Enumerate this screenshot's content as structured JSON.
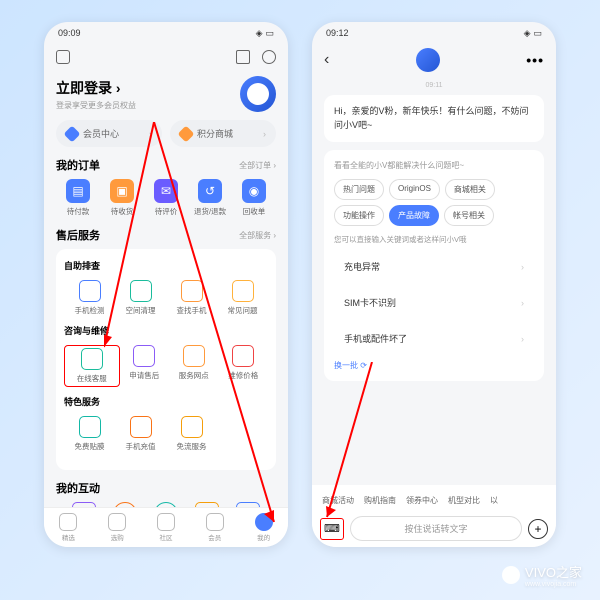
{
  "p1": {
    "time": "09:09",
    "login_title": "立即登录",
    "login_arrow": "›",
    "login_sub": "登录享受更多会员权益",
    "pill1": "会员中心",
    "pill2": "积分商城",
    "orders": {
      "title": "我的订单",
      "more": "全部订单 ›",
      "items": [
        {
          "l": "待付款",
          "c": "#4a7eff"
        },
        {
          "l": "待收货",
          "c": "#ff9a3c"
        },
        {
          "l": "待评价",
          "c": "#6b5cff"
        },
        {
          "l": "退货/退款",
          "c": "#4a7eff"
        },
        {
          "l": "回收单",
          "c": "#4a7eff"
        }
      ]
    },
    "service": {
      "title": "售后服务",
      "more": "全部服务 ›"
    },
    "sub1": "自助排查",
    "g1": [
      {
        "l": "手机检测",
        "c": "#4a7eff"
      },
      {
        "l": "空间清理",
        "c": "#1abc9c"
      },
      {
        "l": "查找手机",
        "c": "#ff9a3c"
      },
      {
        "l": "常见问题",
        "c": "#ffb23c"
      }
    ],
    "sub2": "咨询与维修",
    "g2": [
      {
        "l": "在线客服",
        "c": "#1abc9c"
      },
      {
        "l": "申请售后",
        "c": "#8b5cf6"
      },
      {
        "l": "服务网点",
        "c": "#ff9a3c"
      },
      {
        "l": "维修价格",
        "c": "#ef4444"
      }
    ],
    "sub3": "特色服务",
    "g3": [
      {
        "l": "免费贴膜",
        "c": "#14b8a6"
      },
      {
        "l": "手机充值",
        "c": "#f97316"
      },
      {
        "l": "免流服务",
        "c": "#f59e0b"
      }
    ],
    "interact": "我的互动",
    "tabs": [
      {
        "l": "精选"
      },
      {
        "l": "选购"
      },
      {
        "l": "社区"
      },
      {
        "l": "会员"
      },
      {
        "l": "我的"
      }
    ]
  },
  "p2": {
    "time": "09:12",
    "ts": "09:11",
    "msg": "Hi，亲爱的V粉，新年快乐！有什么问题，不妨问问小V吧~",
    "opts_t": "看看全能的小V都能解决什么问题吧~",
    "chips": [
      "热门问题",
      "OriginOS",
      "商城相关",
      "功能操作",
      "产品故障",
      "帐号相关"
    ],
    "hint": "您可以直接输入关键词或者这样问小V哦",
    "rows": [
      "充电异常",
      "SIM卡不识别",
      "手机或配件坏了"
    ],
    "refresh": "换一批 ⟳",
    "tags": [
      "商城活动",
      "购机指南",
      "领券中心",
      "机型对比",
      "以"
    ],
    "input": "按住说话转文字"
  },
  "wm": {
    "t": "VIVO之家",
    "u": "www.vivojia.com"
  }
}
